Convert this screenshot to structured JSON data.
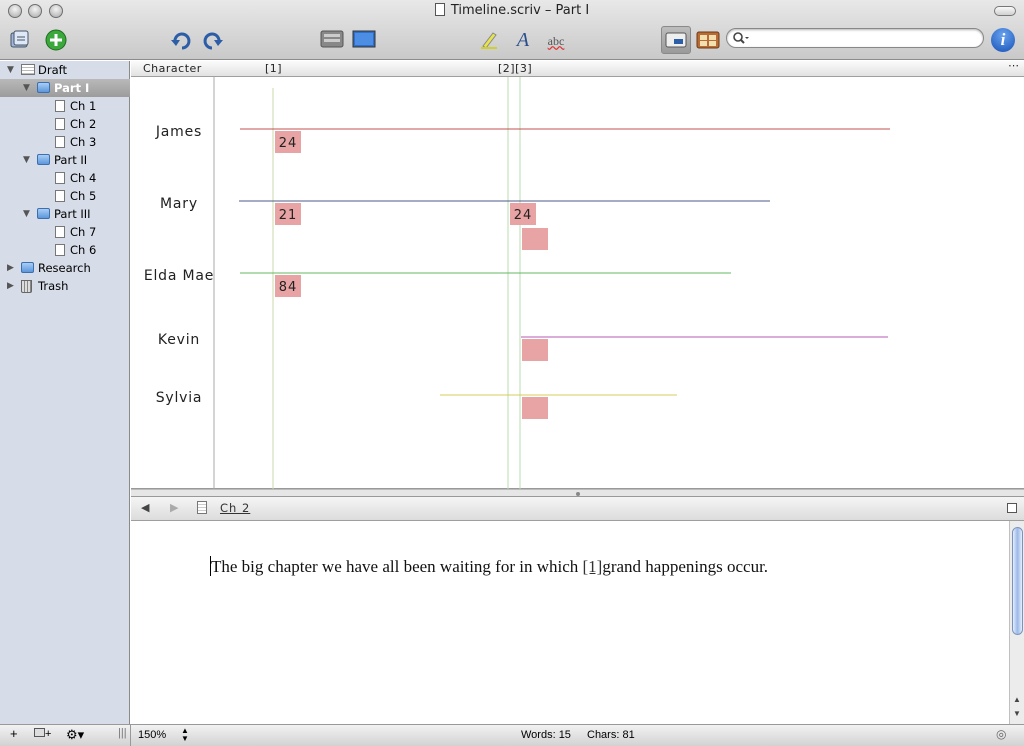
{
  "window": {
    "title": "Timeline.scriv – Part I"
  },
  "toolbar": {
    "search": {
      "placeholder": "",
      "value": ""
    },
    "info_glyph": "i",
    "spelling_glyph": "abc",
    "font_glyph": "A",
    "icons": [
      "binder-icon",
      "add-icon",
      "undo-icon",
      "redo-icon",
      "scrivenings-icon",
      "composition-icon",
      "highlight-icon",
      "fonts-icon",
      "spelling-icon",
      "inspector-toggle-icon",
      "corkboard-icon",
      "search-icon",
      "info-icon"
    ]
  },
  "binder": {
    "items": [
      {
        "label": "Draft",
        "level": 0,
        "expanded": true,
        "icon": "draft-icon"
      },
      {
        "label": "Part I",
        "level": 1,
        "expanded": true,
        "icon": "folder-icon",
        "selected": true
      },
      {
        "label": "Ch 1",
        "level": 2,
        "icon": "page-icon"
      },
      {
        "label": "Ch 2",
        "level": 2,
        "icon": "page-icon"
      },
      {
        "label": "Ch 3",
        "level": 2,
        "icon": "page-icon"
      },
      {
        "label": "Part II",
        "level": 1,
        "expanded": true,
        "icon": "folder-icon"
      },
      {
        "label": "Ch 4",
        "level": 2,
        "icon": "page-icon"
      },
      {
        "label": "Ch 5",
        "level": 2,
        "icon": "page-icon"
      },
      {
        "label": "Part III",
        "level": 1,
        "expanded": true,
        "icon": "folder-icon"
      },
      {
        "label": "Ch 7",
        "level": 2,
        "icon": "page-icon"
      },
      {
        "label": "Ch 6",
        "level": 2,
        "icon": "page-icon"
      },
      {
        "label": "Research",
        "level": 0,
        "expanded": false,
        "icon": "research-folder-icon"
      },
      {
        "label": "Trash",
        "level": 0,
        "expanded": false,
        "icon": "trash-icon"
      }
    ]
  },
  "timeline": {
    "header": {
      "character_label": "Character",
      "markers": [
        "[1]",
        "[2][3]"
      ]
    },
    "colors": {
      "event_fill": "#e8a4a4",
      "marker_line": "#b8dbb0",
      "grid_line": "#c8d8a8"
    },
    "characters": [
      {
        "name": "James",
        "color": "#c0504d",
        "events": [
          {
            "label": "24",
            "slot": 0
          }
        ]
      },
      {
        "name": "Mary",
        "color": "#4b5b8a",
        "events": [
          {
            "label": "21",
            "slot": 0
          },
          {
            "label": "24",
            "slot": 1
          },
          {
            "label": "",
            "slot": 2
          }
        ]
      },
      {
        "name": "Elda Mae",
        "color": "#62b862",
        "events": [
          {
            "label": "84",
            "slot": 0
          }
        ]
      },
      {
        "name": "Kevin",
        "color": "#b458b4",
        "events": [
          {
            "label": "",
            "slot": 2
          }
        ]
      },
      {
        "name": "Sylvia",
        "color": "#d6cc5a",
        "events": [
          {
            "label": "",
            "slot": 2
          }
        ]
      }
    ]
  },
  "editor": {
    "document_title": "Ch  2",
    "text_before": "The big chapter we have all been waiting for in which ",
    "annotation": "[1]",
    "text_after": "grand happenings occur."
  },
  "status": {
    "zoom": "150%",
    "words": "Words: 15",
    "chars": "Chars: 81"
  }
}
